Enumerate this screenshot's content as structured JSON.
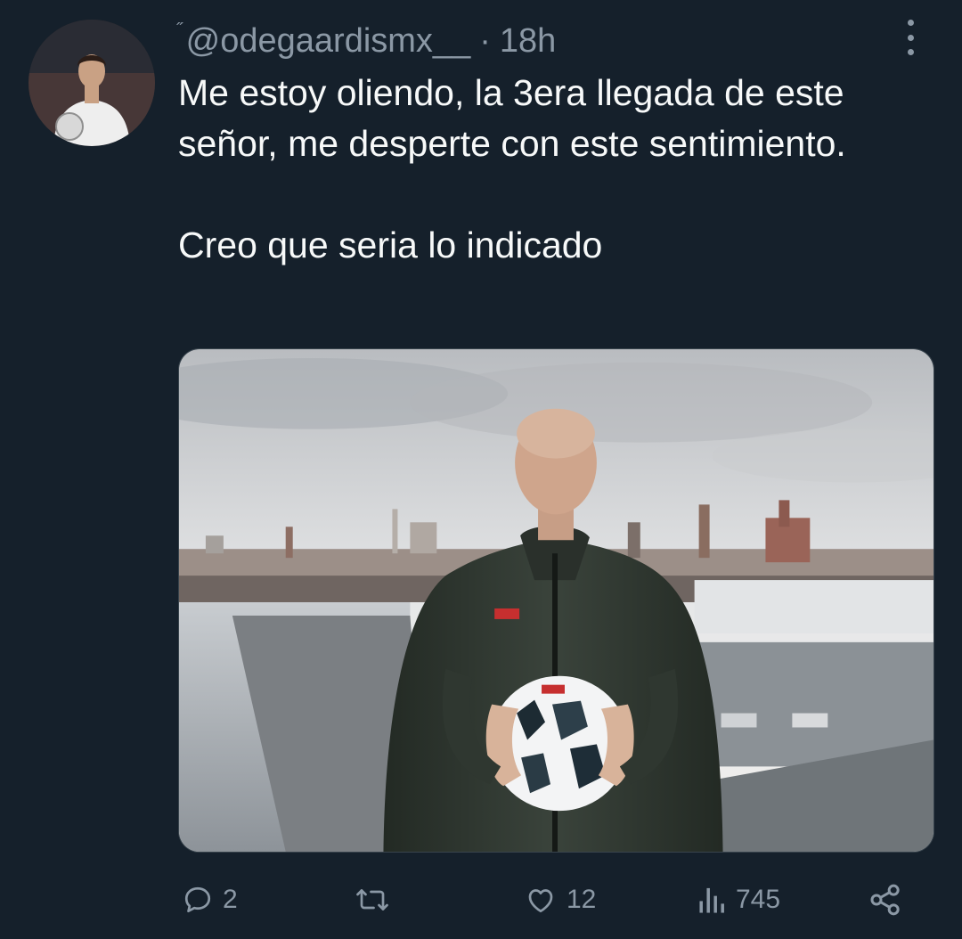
{
  "tweet": {
    "name_mark": "˝",
    "handle": "@odegaardismx__",
    "separator": "·",
    "time": "18h",
    "text_lines": [
      "Me estoy oliendo, la 3era llegada de este señor, me desperte con este sentimiento.",
      "Creo que seria lo indicado"
    ]
  },
  "actions": {
    "reply_count": "2",
    "retweet_count": "",
    "like_count": "12",
    "views_count": "745"
  },
  "icons": {
    "more": "more-vertical-icon",
    "reply": "reply-icon",
    "retweet": "retweet-icon",
    "like": "heart-icon",
    "views": "views-icon",
    "share": "share-icon"
  },
  "colors": {
    "background": "#15202b",
    "text": "#f7f9f9",
    "muted": "#8b98a5"
  }
}
